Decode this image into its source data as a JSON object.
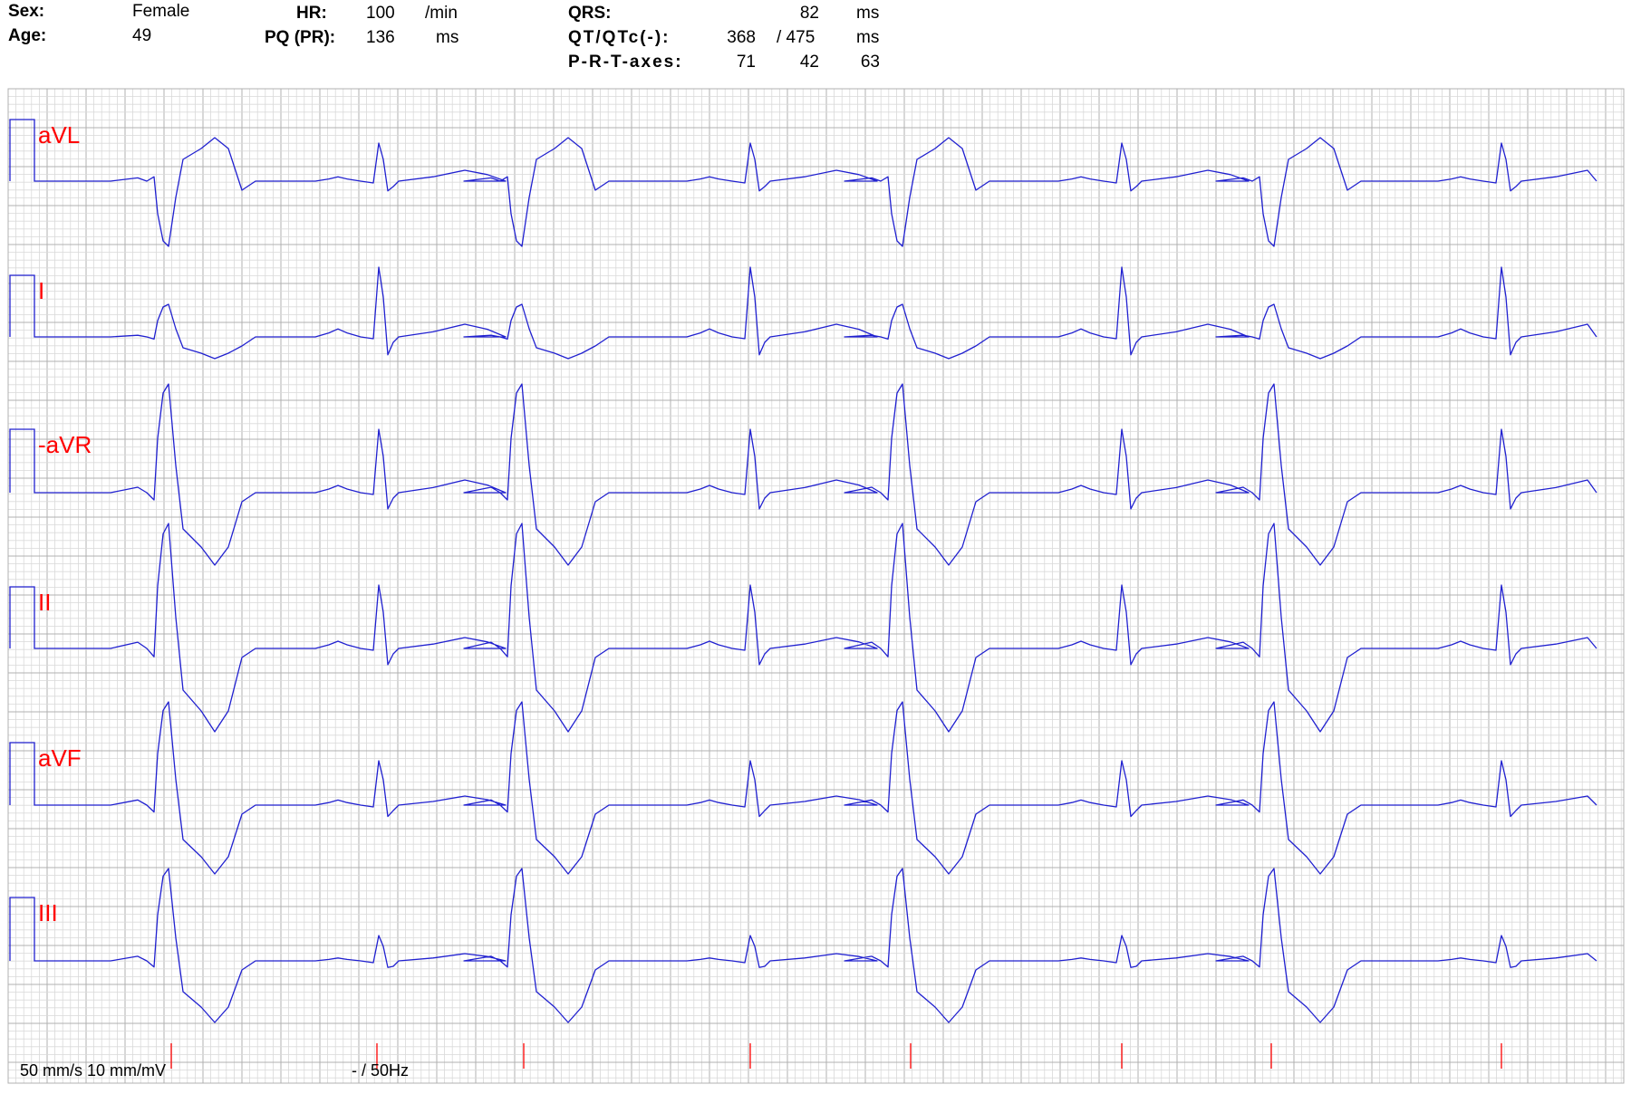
{
  "header": {
    "sex_label": "Sex:",
    "sex_value": "Female",
    "age_label": "Age:",
    "age_value": "49",
    "hr_label": "HR:",
    "hr_value": "100",
    "hr_unit": "/min",
    "pq_label": "PQ (PR):",
    "pq_value": "136",
    "pq_unit": "ms",
    "qrs_label": "QRS:",
    "qrs_value": "82",
    "qrs_unit": "ms",
    "qt_label": "QT/QTc(-):",
    "qt_value": "368",
    "qtc_value": "/ 475",
    "qt_unit": "ms",
    "axes_label": "P-R-T-axes:",
    "axis_p": "71",
    "axis_r": "42",
    "axis_t": "63"
  },
  "leads": [
    {
      "name": "aVL"
    },
    {
      "name": "I"
    },
    {
      "name": "-aVR"
    },
    {
      "name": "II"
    },
    {
      "name": "aVF"
    },
    {
      "name": "III"
    }
  ],
  "footer": {
    "speed_gain": "50 mm/s 10 mm/mV",
    "filter": "- / 50Hz"
  },
  "colors": {
    "trace": "#2020d0",
    "grid_minor": "#d9d9d9",
    "grid_major": "#b0b0b0",
    "lead_label": "#ff0000",
    "beat_marker": "#ff0000"
  }
}
